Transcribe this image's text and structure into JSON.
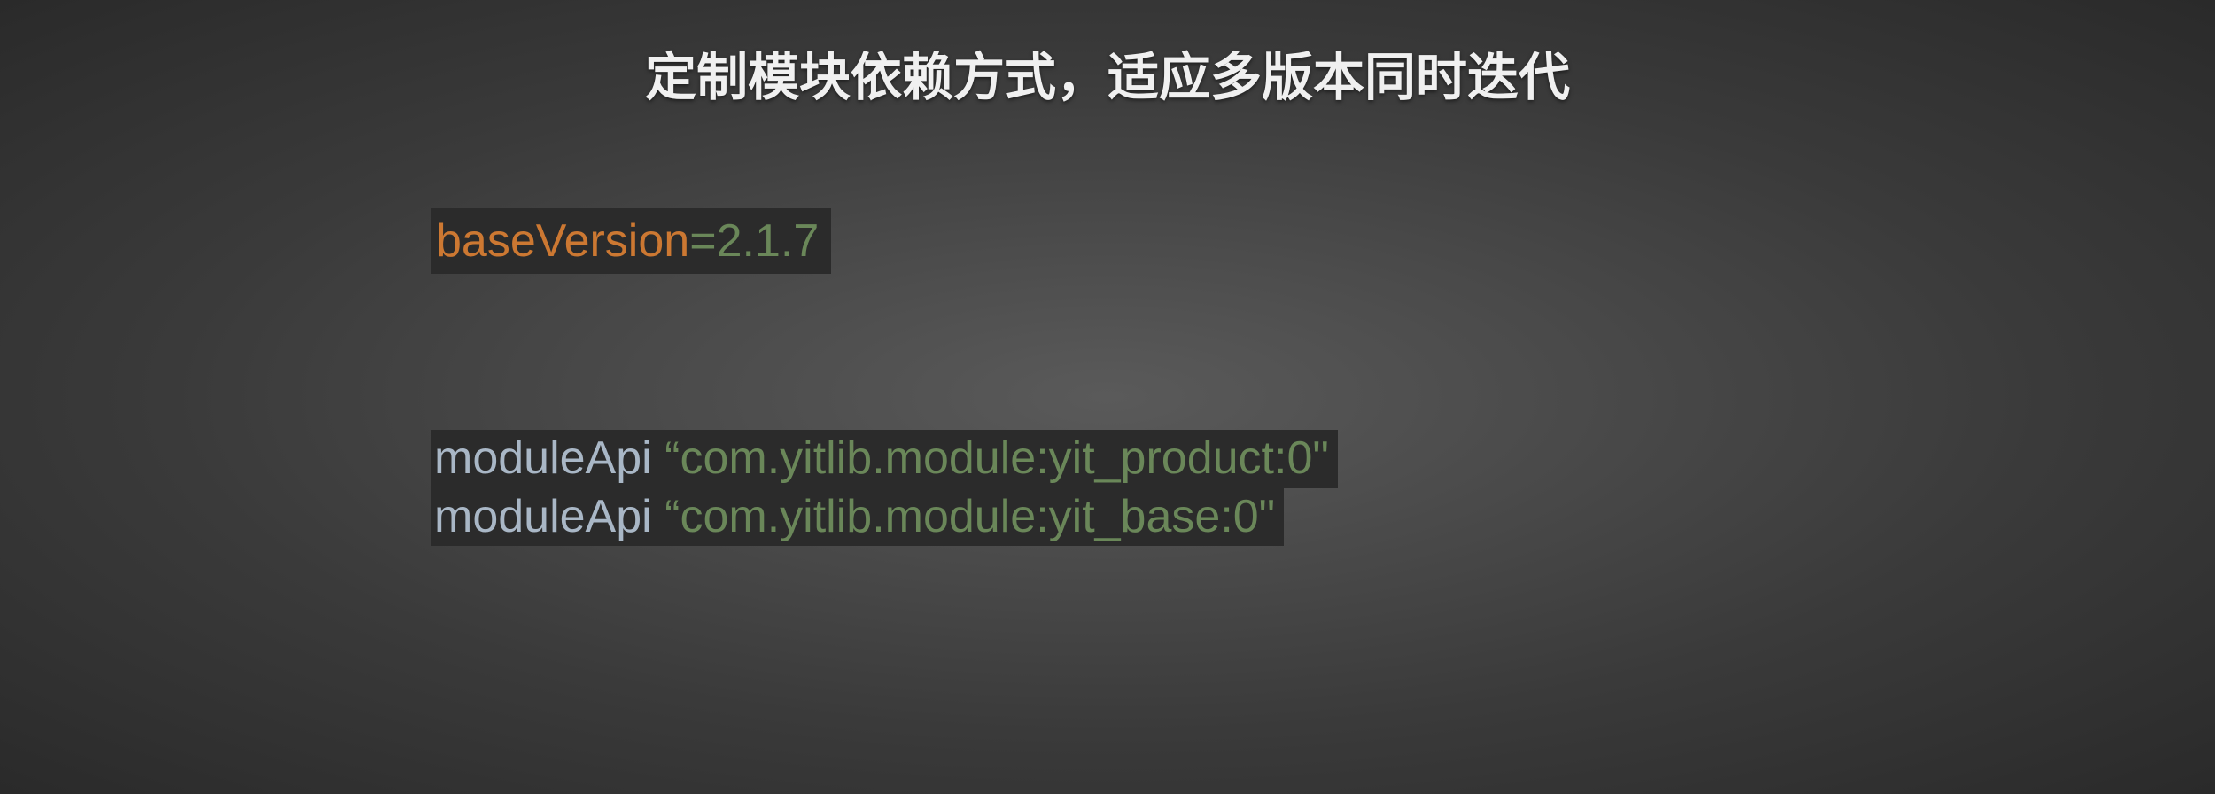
{
  "title": "定制模块依赖方式，适应多版本同时迭代",
  "block1": {
    "baseVersionKey": "baseVersion",
    "equals": "=",
    "version": "2.1.7"
  },
  "block2": {
    "line1": {
      "method": "moduleApi ",
      "quoteOpen": "“",
      "arg": "com.yitlib.module:yit_product:0\""
    },
    "line2": {
      "method": "moduleApi ",
      "quoteOpen": "“",
      "arg": "com.yitlib.module:yit_base:0\""
    }
  }
}
